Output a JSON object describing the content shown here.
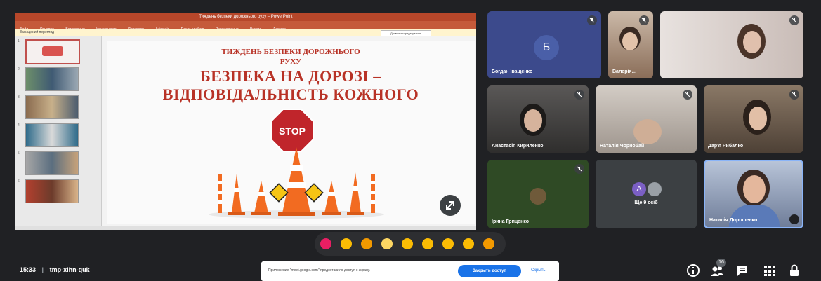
{
  "presentation": {
    "window_title": "Тиждень безпеки дорожнього руху – PowerPoint",
    "ribbon": [
      "Файл",
      "Основне",
      "Вставлення",
      "Конструктор",
      "Переходи",
      "Анімація",
      "Показ слайдів",
      "Рецензування",
      "Вигляд",
      "Довідка"
    ],
    "info_bar": "Захищений перегляд",
    "info_button": "Дозволити редагування",
    "slide": {
      "line1": "ТИЖДЕНЬ БЕЗПЕКИ ДОРОЖНЬОГО",
      "line2": "РУХУ",
      "line3": "БЕЗПЕКА НА ДОРОЗІ –",
      "line4": "ВІДПОВІДАЛЬНІСТЬ КОЖНОГО",
      "sign_text": "STOP"
    },
    "thumb_numbers": [
      "1",
      "2",
      "3",
      "4",
      "5",
      "6"
    ]
  },
  "participants": [
    {
      "name": "Богдан Іващенко",
      "avatar": "Б",
      "color": "#3c4a8c"
    },
    {
      "name": "Валерія…",
      "color": "#a78b74"
    },
    {
      "name": "",
      "color": "#d9d2cf"
    },
    {
      "name": "Анастасія Кириленко",
      "color": "#4a4847"
    },
    {
      "name": "Наталія Чорнобай",
      "color": "#b7b1ab"
    },
    {
      "name": "Дар'я Рибалко",
      "color": "#6b5a4c"
    },
    {
      "name": "Ірина Гриценко",
      "color": "#2f4a25"
    },
    {
      "name": "Ще 9 осіб",
      "avatar": "А",
      "color": "#3c4043"
    },
    {
      "name": "Наталія Дорошенко",
      "color": "#8c9bb5"
    }
  ],
  "reactions": [
    "heart-icon",
    "thumbs-up-icon",
    "party-popper-icon",
    "clap-icon",
    "laugh-icon",
    "surprised-icon",
    "sad-icon",
    "thinking-icon",
    "thumbs-down-icon"
  ],
  "meeting": {
    "time": "15:33",
    "separator": "|",
    "code": "tmp-xihn-quk"
  },
  "notification": {
    "text": "Приложение \"meet.google.com\" предоставило доступ к экрану.",
    "button": "Закрыть доступ",
    "link": "Скрыть"
  },
  "toolbar": {
    "participants_badge": "16"
  },
  "colors": {
    "background": "#202124",
    "accent": "#1a73e8",
    "ppt_red": "#b7472a",
    "slide_text": "#b83226",
    "cone": "#f26b21"
  }
}
